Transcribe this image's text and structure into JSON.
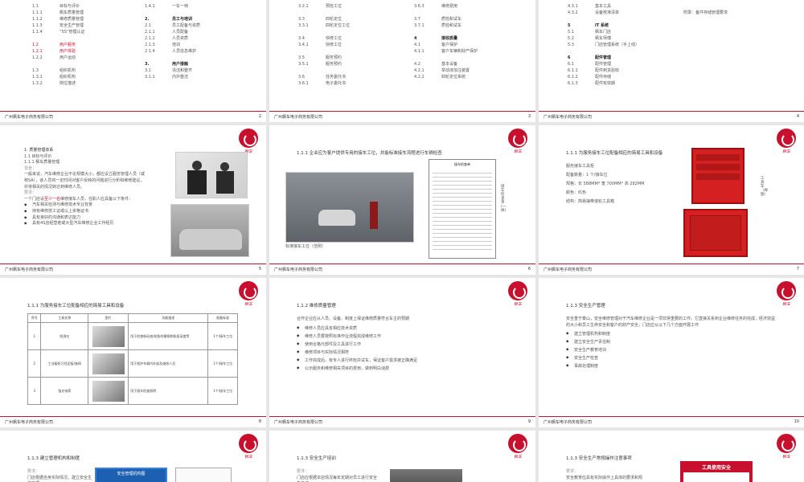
{
  "company": "广州枫车电子商务有限公司",
  "logo_text": "枫车",
  "s2": {
    "page": "2",
    "col1": [
      [
        "1.1",
        "目标与评价"
      ],
      [
        "1.1.1",
        "枫车质量管理"
      ],
      [
        "1.1.2",
        "维修质量管理"
      ],
      [
        "1.1.3",
        "安全生产管理"
      ],
      [
        "1.1.4",
        "“5S”管理认证"
      ],
      [
        "",
        ""
      ],
      [
        "1.2",
        "用户服务"
      ],
      [
        "1.2.1",
        "用户体验"
      ],
      [
        "1.2.2",
        "用户运动"
      ],
      [
        "",
        ""
      ],
      [
        "1.3",
        "组织机构"
      ],
      [
        "1.3.1",
        "组织机构"
      ],
      [
        "1.3.2",
        "岗位描述"
      ]
    ],
    "col2": [
      [
        "1.4.1",
        "一车一档"
      ],
      [
        "",
        ""
      ],
      [
        "2.",
        "员工与培训"
      ],
      [
        "2.1",
        "员工配备与资质"
      ],
      [
        "2.1.1",
        "人员配备"
      ],
      [
        "2.1.2",
        "人员资质"
      ],
      [
        "2.1.3",
        "培训"
      ],
      [
        "2.1.4",
        "人员信息维护"
      ],
      [
        "",
        ""
      ],
      [
        "3.",
        "用户接触"
      ],
      [
        "3.1",
        "清洁和整齐"
      ],
      [
        "3.1.1",
        "内外整洁"
      ]
    ]
  },
  "s3": {
    "page": "3",
    "col1": [
      [
        "3.2.1",
        "预检工位"
      ],
      [
        "",
        ""
      ],
      [
        "3.3",
        "四轮定位"
      ],
      [
        "3.3.1",
        "四轮定位工位"
      ],
      [
        "",
        ""
      ],
      [
        "3.4",
        "快修工位"
      ],
      [
        "3.4.1",
        "快修工位"
      ],
      [
        "",
        ""
      ],
      [
        "3.5",
        "服务预约"
      ],
      [
        "3.5.1",
        "服务预约"
      ],
      [
        "",
        ""
      ],
      [
        "3.6",
        "任务委托书"
      ],
      [
        "3.6.1",
        "电子委托书"
      ]
    ],
    "col2": [
      [
        "3.6.3",
        "维修费用"
      ],
      [
        "",
        ""
      ],
      [
        "3.7",
        "质检和试车"
      ],
      [
        "3.7.1",
        "质检和试车"
      ],
      [
        "",
        ""
      ],
      [
        "4",
        "接收质量"
      ],
      [
        "4.1",
        "客户保护"
      ],
      [
        "4.1.1",
        "客户车辆和财产保护"
      ],
      [
        "",
        ""
      ],
      [
        "4.2",
        "基本设备"
      ],
      [
        "4.2.1",
        "举动液加注装置"
      ],
      [
        "4.2.2",
        "四轮定位系统"
      ]
    ]
  },
  "s4": {
    "page": "4",
    "col1": [
      [
        "4.3.1",
        "基本工具"
      ],
      [
        "4.3.2",
        "设备校准清单"
      ],
      [
        "",
        ""
      ],
      [
        "5",
        "IT 系统"
      ],
      [
        "5.1",
        "枫车门店"
      ],
      [
        "5.2",
        "枫车师傅"
      ],
      [
        "5.3",
        "门店管理系统（手上线）"
      ],
      [
        "",
        ""
      ],
      [
        "6",
        "配件管理"
      ],
      [
        "6.1",
        "配件管理"
      ],
      [
        "6.1.1",
        "配件到货验收"
      ],
      [
        "6.1.2",
        "配件存储"
      ],
      [
        "6.1.3",
        "配件有效期"
      ]
    ],
    "note": "附录：备件存储管理要求"
  },
  "s5": {
    "page": "5",
    "title": "1. 质量管理体系",
    "sub1": "1.1 目标与评价",
    "sub2": "1.1.1 枫车质量管理",
    "lbl1": "背景：",
    "p1": "一般来说，汽车维修企业不论规模大小，都应设立服务管理人员（或称SA），该人员将一定时间对客户反映的问题进行分析和维修建议，并将相关的情况转达到维修人员。",
    "lbl2": "要求：",
    "p2a": "一个门店设",
    "p2red": "至少一名",
    "p2b": "维修接车人员，任职人应具备以下条件：",
    "bullets": [
      "汽车相关检测与维修技术专业背景",
      "持有维修技工证或以上资格证书",
      "具有良好的沟通和表达能力",
      "具有4S店经营者或大型汽车维修企业工作经历"
    ]
  },
  "s6": {
    "page": "6",
    "title": "1.1.1 企业应为客户提供专用的接车工位，并能标准接车流程进行车辆检查",
    "caption": "标准接车工位（范例）",
    "side": "接车检查单(一样)",
    "form_title": "接车检查单"
  },
  "s7": {
    "page": "7",
    "title": "1.1.1 为服务接车工位配备相应的简易工具和设备",
    "rows": [
      "服务接车工具柜",
      "配备数量：1 个/接车位",
      "规格：长 588MM* 宽 700MM* 高 282MM",
      "颜色：红色",
      "结构：简易抽带滚轮工具箱"
    ],
    "side": "工具车（样图）"
  },
  "s8": {
    "page": "8",
    "title": "1.1.1 为服务接车工位配备相应的简易工具和设备",
    "headers": [
      "序号",
      "工具名称",
      "图片",
      "功能描述",
      "配备标准"
    ],
    "rows": [
      [
        "1",
        "检测仪",
        "",
        "用于检查制动液/轮胎的磨损和胎面深度等",
        "1个/接车工位"
      ],
      [
        "2",
        "工业级防污挡泥板/座椅",
        "",
        "用于保护车辆内外部及维修人员",
        "1个/接车工位"
      ],
      [
        "3",
        "强光电筒",
        "",
        "用于接车检查照明",
        "1个/接车工位"
      ]
    ]
  },
  "s9": {
    "page": "9",
    "title": "1.1.2 维修质量管理",
    "intro": "合作企业应从人员、设备、制度上保证维修质量符合车主的预期",
    "bullets": [
      "维修人员应具有相应技术资质",
      "维修人员要按照标准作业流程完成维修工作",
      "使用合格元部件及工具进行工作",
      "维修项目与实际情况相符",
      "工作完成后，有专人进行终检并试车，保证客户需求被正确满足",
      "公示服务和维修相关项目的费用，做到明白消费"
    ]
  },
  "s10": {
    "page": "10",
    "title": "1.1.3 安全生产管理",
    "intro": "安全重于泰山，安全维修管理对于汽车维修企业是一项非常重要的工作，它直接关系到企业维修任务的完成，经济效益的大小和员工生命安全和客户的财产安全，门店应从以下几个方面开展工作",
    "bullets": [
      "建立管理机构和制度",
      "建立安全生产责任制",
      "安全生产教育培训",
      "安全生产检查",
      "事故处理制度"
    ]
  },
  "s11": {
    "title": "1.1.3 建立管理机构和制度",
    "lbl": "要求：",
    "p": "门店根据自身实际情况，建立安全生产管理",
    "board": "安全管理机构图"
  },
  "s12": {
    "title": "1.1.3 安全生产培训",
    "lbl": "要求：",
    "p": "门店应根据本店情况每年定期对员工进行安全生产培"
  },
  "s13": {
    "title": "1.1.3 安全生产常规操作注意事项",
    "lbl": "要求：",
    "p": "安全教育应具有实际操作上具体的要求和规",
    "sign": "工具使用安全"
  }
}
